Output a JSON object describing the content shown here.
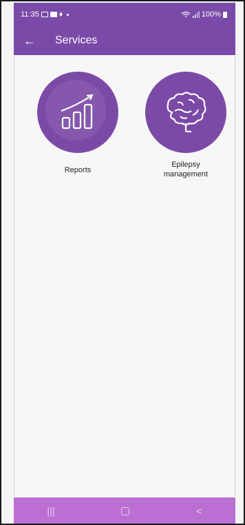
{
  "status_bar": {
    "time": "11:35",
    "battery": "100%",
    "icons": [
      "photo-icon",
      "mail-icon",
      "sound-icon",
      "dot-icon",
      "wifi-icon",
      "signal-icon",
      "battery-icon"
    ]
  },
  "app_bar": {
    "back_icon": "←",
    "title": "Services"
  },
  "services": [
    {
      "label": "Reports",
      "icon": "bar-chart-growth-icon"
    },
    {
      "label": "Epilepsy\nmanagement",
      "icon": "brain-icon"
    }
  ],
  "nav_bar": {
    "recents": "|||",
    "back": "<"
  },
  "colors": {
    "primary": "#7a4aa8",
    "nav_bar": "#bb6fd2",
    "background": "#f7f7f7"
  }
}
